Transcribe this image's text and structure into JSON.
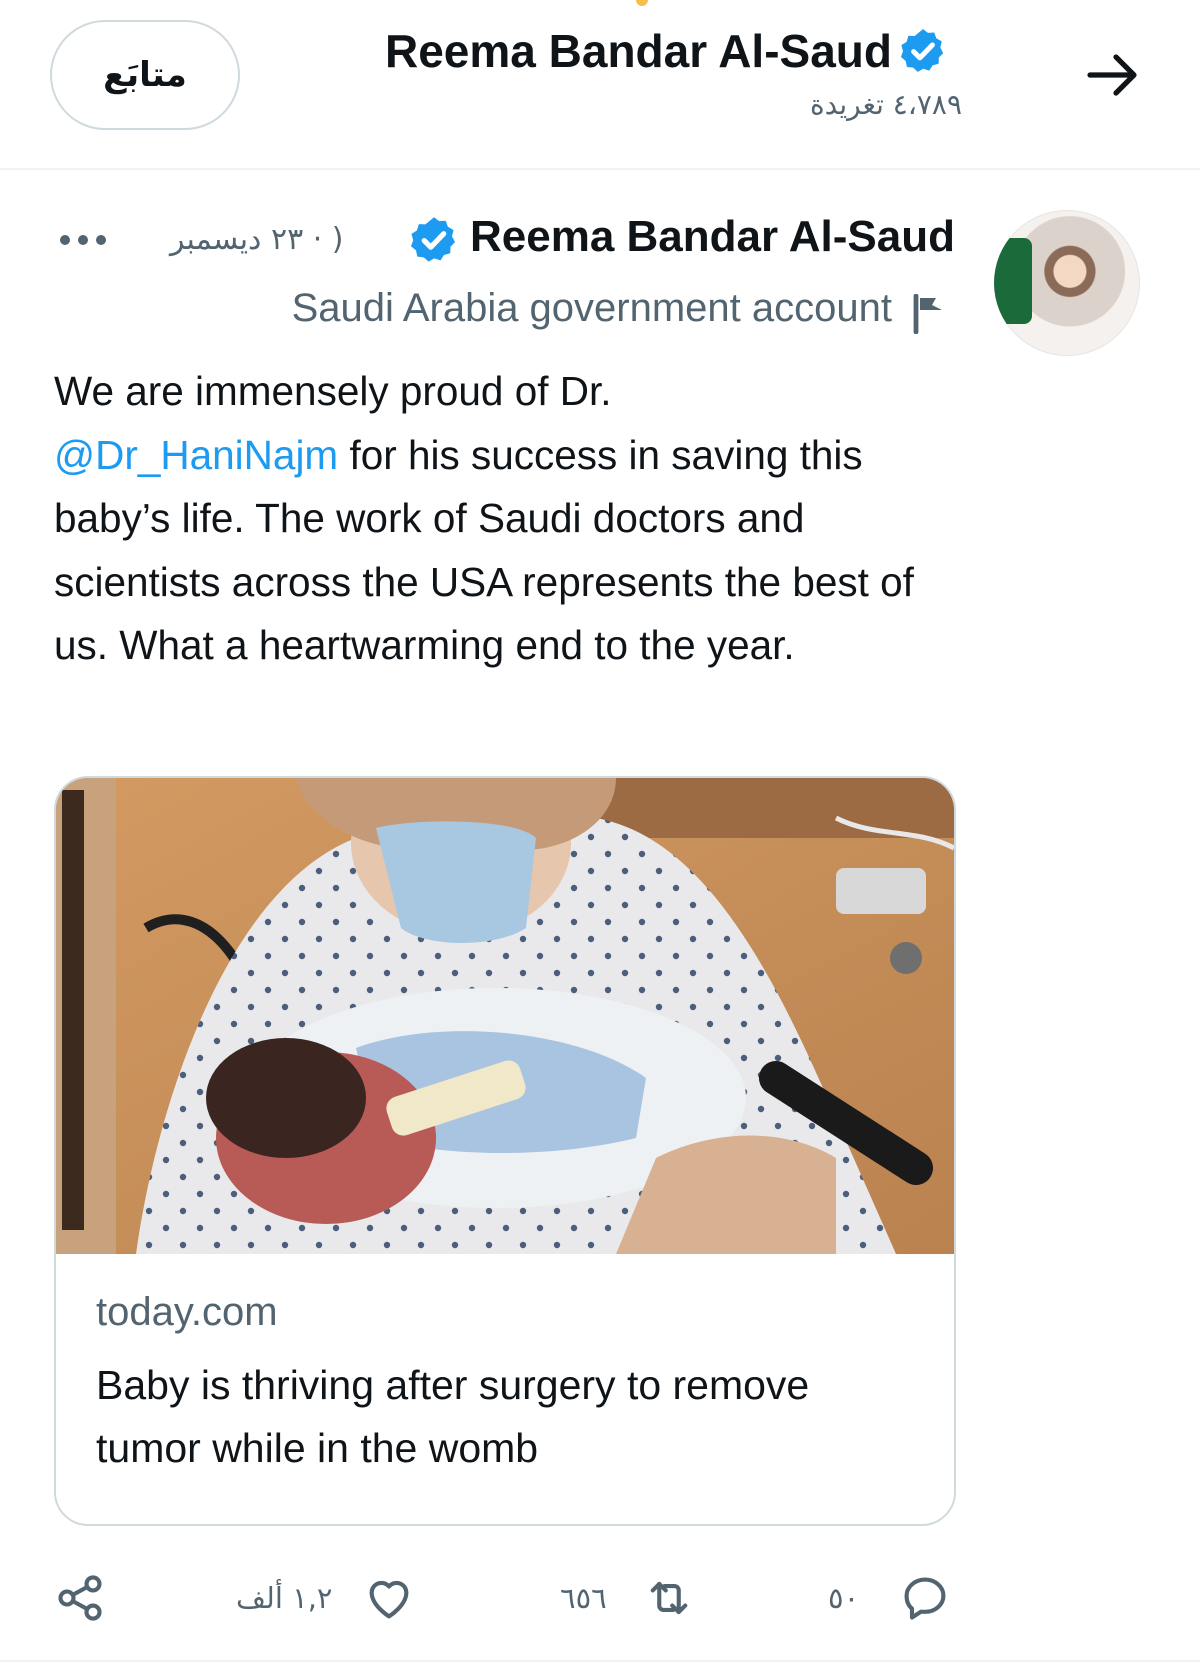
{
  "header": {
    "follow_label": "متابَع",
    "display_name": "Reema Bandar Al-Saud",
    "tweet_count": "٤،٧٨٩ تغريدة"
  },
  "tweet": {
    "author_name": "Reema Bandar Al-Saud",
    "meta": "( · ٢٣ ديسمبر",
    "label": "Saudi Arabia government account",
    "text_before_mention": "We are immensely proud of Dr.",
    "mention": "@Dr_HaniNajm",
    "text_after_mention": " for his success in saving this baby’s life. The work of Saudi doctors and scientists across the USA represents the best of us. What a heartwarming end to the year.",
    "card": {
      "domain": "today.com",
      "title": "Baby is thriving after surgery to remove tumor while in the womb"
    },
    "actions": {
      "replies": "٥٠",
      "retweets": "٦٥٦",
      "likes": "١,٢ ألف"
    }
  },
  "colors": {
    "accent_blue": "#1d9bf0",
    "muted_text": "#536471",
    "border": "#cfd9de"
  },
  "icons": [
    "back-arrow-icon",
    "verified-badge-icon",
    "more-icon",
    "government-flag-icon",
    "reply-icon",
    "retweet-icon",
    "like-icon",
    "share-icon"
  ]
}
